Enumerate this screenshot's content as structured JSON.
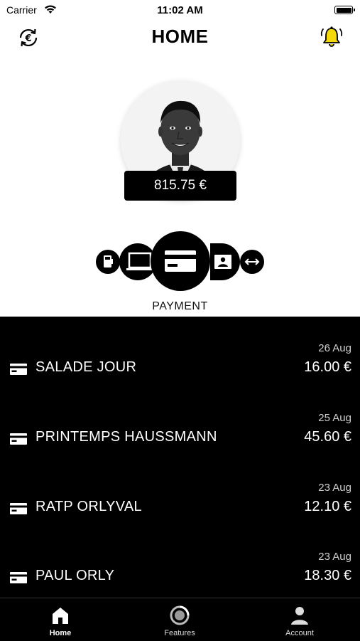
{
  "status": {
    "carrier": "Carrier",
    "time": "11:02 AM"
  },
  "header": {
    "title": "HOME",
    "left_icon": "euro-exchange-icon",
    "right_icon": "bell-icon"
  },
  "profile": {
    "balance": "815.75 €"
  },
  "carousel": {
    "selected_label": "PAYMENT",
    "items": [
      "card-reader-icon",
      "laptop-icon",
      "credit-card-icon",
      "id-card-icon",
      "transfer-arrows-icon"
    ]
  },
  "transactions": [
    {
      "date": "26 Aug",
      "name": "SALADE JOUR",
      "amount": "16.00 €"
    },
    {
      "date": "25 Aug",
      "name": "PRINTEMPS HAUSSMANN",
      "amount": "45.60 €"
    },
    {
      "date": "23 Aug",
      "name": "RATP ORLYVAL",
      "amount": "12.10 €"
    },
    {
      "date": "23 Aug",
      "name": "PAUL ORLY",
      "amount": "18.30 €"
    }
  ],
  "tabs": [
    {
      "label": "Home",
      "icon": "home-icon"
    },
    {
      "label": "Features",
      "icon": "features-icon"
    },
    {
      "label": "Account",
      "icon": "person-icon"
    }
  ],
  "colors": {
    "bell": "#F5D90A",
    "background": "#FFFFFF",
    "list_background": "#000000"
  }
}
